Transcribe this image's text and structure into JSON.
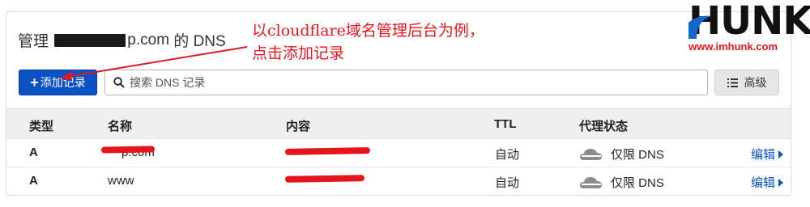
{
  "header": {
    "title_prefix": "管理 ",
    "title_domain_suffix": "p.com",
    "title_suffix": " 的 DNS"
  },
  "toolbar": {
    "add_label": "添加记录",
    "search_placeholder": "搜索 DNS 记录",
    "advanced_label": "高级"
  },
  "table": {
    "columns": [
      "类型",
      "名称",
      "内容",
      "TTL",
      "代理状态"
    ],
    "rows": [
      {
        "type": "A",
        "name": "p.com",
        "ttl": "自动",
        "proxy": "仅限 DNS",
        "action": "编辑"
      },
      {
        "type": "A",
        "name": "www",
        "ttl": "自动",
        "proxy": "仅限 DNS",
        "action": "编辑"
      }
    ]
  },
  "annotation": {
    "line1": "以cloudflare域名管理后台为例，",
    "line2": "点击添加记录"
  },
  "logo": {
    "word": "HUNK",
    "url": "www.imhunk.com"
  },
  "colors": {
    "primary": "#0a51c4",
    "annotation": "#e3171d",
    "cloud_gray": "#8c8c8c"
  }
}
